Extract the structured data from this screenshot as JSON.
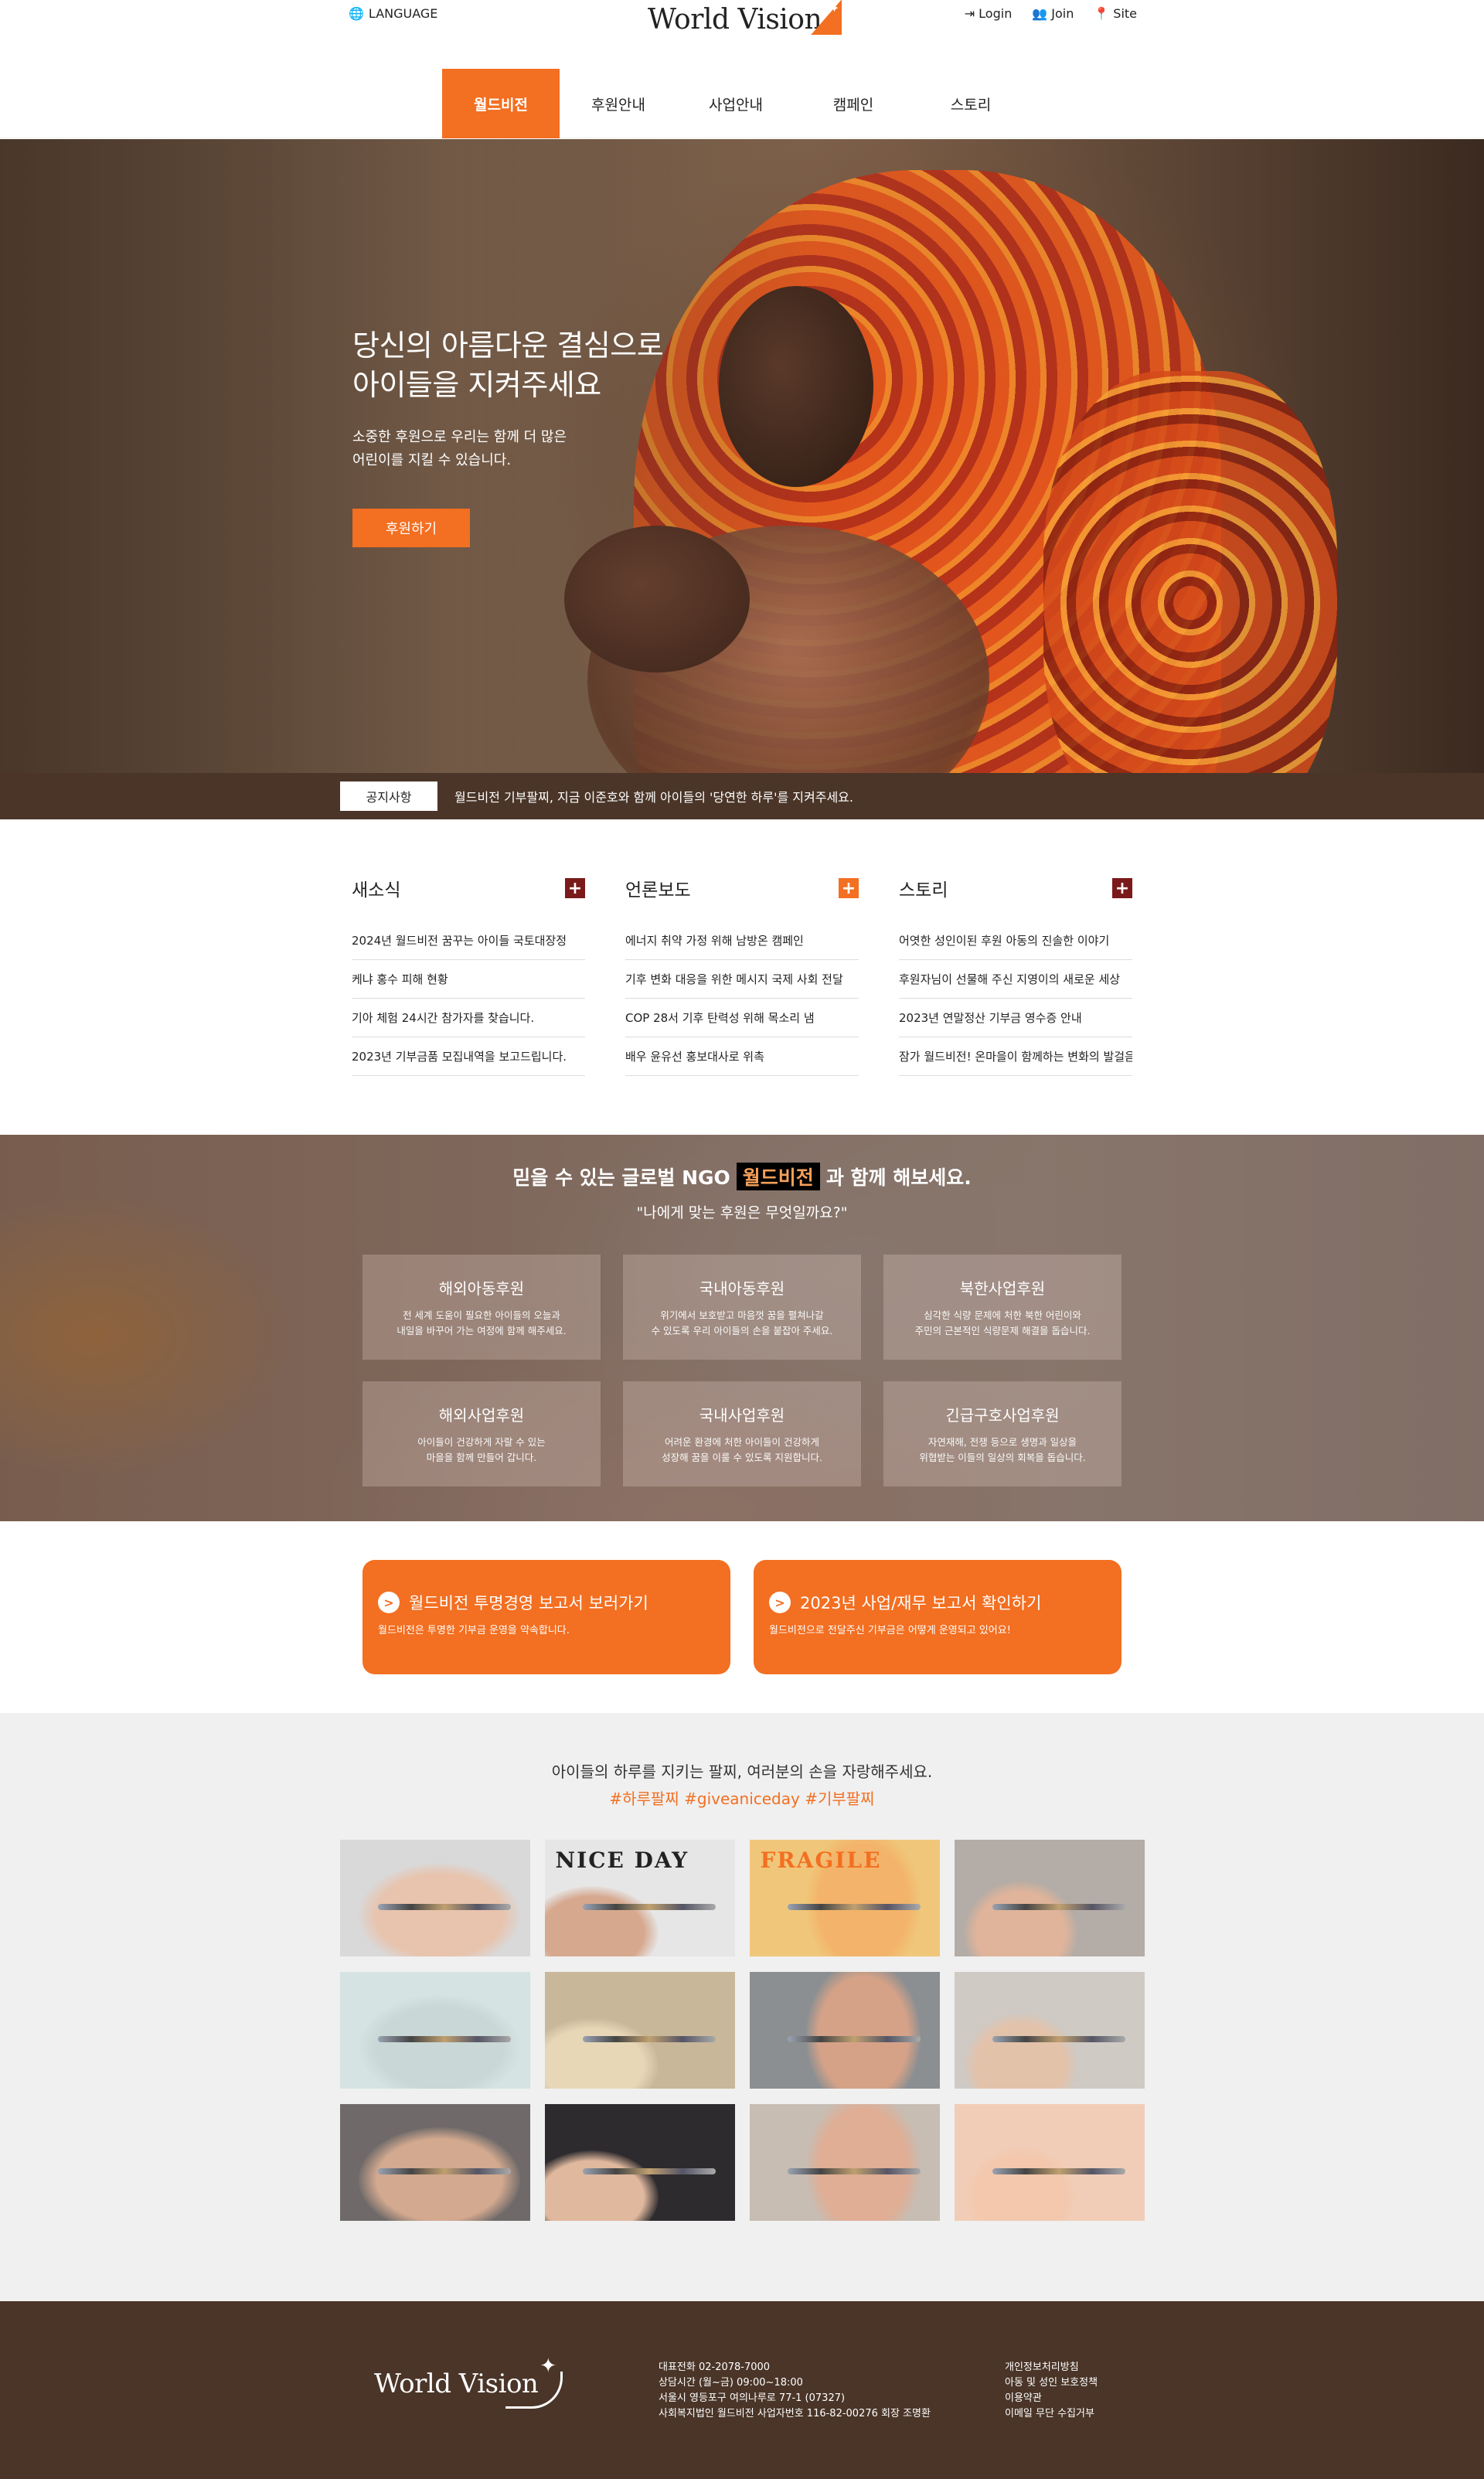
{
  "header": {
    "language_label": "LANGUAGE",
    "logo_text": "World Vision",
    "util": [
      {
        "label": "Login",
        "icon": "login-icon"
      },
      {
        "label": "Join",
        "icon": "users-icon"
      },
      {
        "label": "Site",
        "icon": "map-pin-icon"
      }
    ]
  },
  "nav": {
    "items": [
      "월드비전",
      "후원안내",
      "사업안내",
      "캠페인",
      "스토리"
    ],
    "active": "월드비전"
  },
  "hero": {
    "title_line1": "당신의 아름다운 결심으로",
    "title_line2": "아이들을 지켜주세요",
    "desc_line1": "소중한 후원으로 우리는 함께 더 많은",
    "desc_line2": "어린이를 지킬 수 있습니다.",
    "button": "후원하기"
  },
  "notice": {
    "tag": "공지사항",
    "text": "월드비전 기부팔찌, 지금 이준호와 함께 아이들의 '당연한 하루'를 지켜주세요."
  },
  "news": {
    "columns": [
      {
        "title": "새소식",
        "plus_color": "#7a1a1a",
        "items": [
          "2024년 월드비전 꿈꾸는 아이들 국토대장정",
          "케냐 홍수 피해 현황",
          "기아 체험 24시간 참가자를 찾습니다.",
          "2023년 기부금품 모집내역을 보고드립니다."
        ]
      },
      {
        "title": "언론보도",
        "plus_color": "#f36f21",
        "items": [
          "에너지 취약 가정 위해 남방온 캠페인",
          "기후 변화 대응을 위한 메시지 국제 사회 전달",
          "COP 28서 기후 탄력성 위해 목소리 냄",
          "배우 윤유선 홍보대사로 위촉"
        ]
      },
      {
        "title": "스토리",
        "plus_color": "#7a1a1a",
        "items": [
          "어엿한 성인이된 후원 아동의 진솔한 이야기",
          "후원자님이 선물해 주신 지영이의 새로운 세상",
          "2023년 연말정산 기부금 영수증 안내",
          "잠가 월드비전! 온마을이 함께하는 변화의 발걸음"
        ]
      }
    ]
  },
  "support": {
    "title_before": "믿을 수 있는 글로벌 NGO",
    "title_highlight": "월드비전",
    "title_after": "과 함께 해보세요.",
    "subtitle": "\"나에게 맞는 후원은 무엇일까요?\"",
    "cards": [
      {
        "title": "해외아동후원",
        "line1": "전 세계 도움이 필요한 아이들의 오늘과",
        "line2": "내일을 바꾸어 가는 여정에 함께 해주세요."
      },
      {
        "title": "국내아동후원",
        "line1": "위기에서 보호받고 마음껏 꿈을 펼쳐나갈",
        "line2": "수 있도록 우리 아이들의 손을 붙잡아 주세요."
      },
      {
        "title": "북한사업후원",
        "line1": "심각한 식량 문제에 처한 북한 어린이와",
        "line2": "주민의 근본적인 식량문제 해결을 돕습니다."
      },
      {
        "title": "해외사업후원",
        "line1": "아이들이 건강하게 자랄 수 있는",
        "line2": "마을을 함께 만들어 갑니다."
      },
      {
        "title": "국내사업후원",
        "line1": "어려운 환경에 처한 아이들이 건강하게",
        "line2": "성장해 꿈을 이룰 수 있도록 지원합니다."
      },
      {
        "title": "긴급구호사업후원",
        "line1": "자연재해, 전쟁 등으로 생명과 일상을",
        "line2": "위협받는 이들의 일상의 회복을 돕습니다."
      }
    ]
  },
  "reports": [
    {
      "title": "월드비전 투명경영 보고서 보러가기",
      "desc": "월드비전은 투명한 기부금 운영을 약속합니다."
    },
    {
      "title": "2023년 사업/재무 보고서 확인하기",
      "desc": "월드비전으로 전달주신 기부금은 어떻게 운영되고 있어요!"
    }
  ],
  "gallery": {
    "line1": "아이들의 하루를 지키는 팔찌, 여러분의 손을 자랑해주세요.",
    "line2": "#하루팔찌 #giveaniceday #기부팔찌",
    "photos": [
      {
        "bg": "#d9d9d9",
        "skin": "#e8c3ad",
        "caption": ""
      },
      {
        "bg": "#e6e6e6",
        "skin": "#d6a88e",
        "caption": "NICE DAY"
      },
      {
        "bg": "#f0c77a",
        "skin": "#f3b36a",
        "caption": "FRAGILE"
      },
      {
        "bg": "#b4aca6",
        "skin": "#e0b49a",
        "caption": ""
      },
      {
        "bg": "#d5e3e2",
        "skin": "#c9d7d6",
        "caption": ""
      },
      {
        "bg": "#c9b79a",
        "skin": "#e7d7b6",
        "caption": ""
      },
      {
        "bg": "#8c8f92",
        "skin": "#d6a287",
        "caption": ""
      },
      {
        "bg": "#cfcac4",
        "skin": "#e3c2aa",
        "caption": ""
      },
      {
        "bg": "#6f6a69",
        "skin": "#d3a98f",
        "caption": ""
      },
      {
        "bg": "#2d2b2e",
        "skin": "#e0b89e",
        "caption": ""
      },
      {
        "bg": "#c7bdb3",
        "skin": "#dfae95",
        "caption": ""
      },
      {
        "bg": "#f1cdb8",
        "skin": "#f3c8ad",
        "caption": ""
      }
    ]
  },
  "footer": {
    "logo_text": "World Vision",
    "info": [
      "대표전화 02-2078-7000",
      "상담시간 (월~금) 09:00~18:00",
      "서울시 영등포구 여의나루로 77-1 (07327)",
      "사회복지법인 월드비전 사업자번호 116-82-00276 회장 조명환"
    ],
    "links": [
      "개인정보처리방침",
      "아동 및 성인 보호정책",
      "이용약관",
      "이메일 무단 수집거부"
    ]
  },
  "colors": {
    "accent": "#f36f21",
    "brown": "#4a3528",
    "dark_red": "#7a1a1a"
  }
}
